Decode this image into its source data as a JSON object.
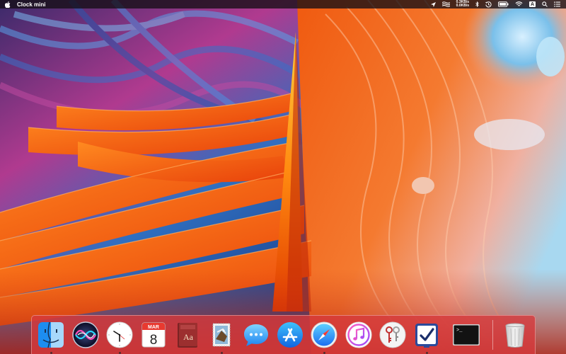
{
  "menubar": {
    "app_name": "Clock mini",
    "net_up": "0.3KB/s",
    "net_down": "0.0KB/s",
    "input_source": "A",
    "icons": [
      "apple-icon",
      "location-arrow-icon",
      "istat-wave-icon",
      "bluetooth-icon",
      "time-machine-icon",
      "battery-icon",
      "wifi-icon",
      "spotlight-search-icon",
      "notification-center-icon"
    ]
  },
  "dock": {
    "calendar_month": "MAR",
    "calendar_day": "8",
    "dictionary_text": "Aa",
    "terminal_prompt": ">_",
    "apps": [
      {
        "name": "Finder",
        "icon": "finder-icon",
        "running": true
      },
      {
        "name": "Siri",
        "icon": "siri-icon",
        "running": false
      },
      {
        "name": "Clock mini",
        "icon": "clock-icon",
        "running": true
      },
      {
        "name": "Calendar",
        "icon": "calendar-icon",
        "running": false
      },
      {
        "name": "Dictionary",
        "icon": "dictionary-icon",
        "running": false
      },
      {
        "name": "Mail",
        "icon": "mail-stamp-icon",
        "running": true
      },
      {
        "name": "Messages",
        "icon": "messages-icon",
        "running": false
      },
      {
        "name": "App Store",
        "icon": "app-store-icon",
        "running": false
      },
      {
        "name": "Safari",
        "icon": "safari-compass-icon",
        "running": true
      },
      {
        "name": "iTunes",
        "icon": "itunes-note-icon",
        "running": false
      },
      {
        "name": "Keychain Access",
        "icon": "keychain-keys-icon",
        "running": false
      },
      {
        "name": "Task Checker",
        "icon": "checkmark-app-icon",
        "running": true
      },
      {
        "name": "Terminal",
        "icon": "terminal-icon",
        "running": false
      },
      {
        "name": "Trash",
        "icon": "trash-icon",
        "running": false
      }
    ]
  },
  "colors": {
    "wallpaper_orange": "#f04a10",
    "wallpaper_blue": "#2f7fcf",
    "wallpaper_purple": "#8a2f8a",
    "dock_tint": "#d63a3c"
  }
}
